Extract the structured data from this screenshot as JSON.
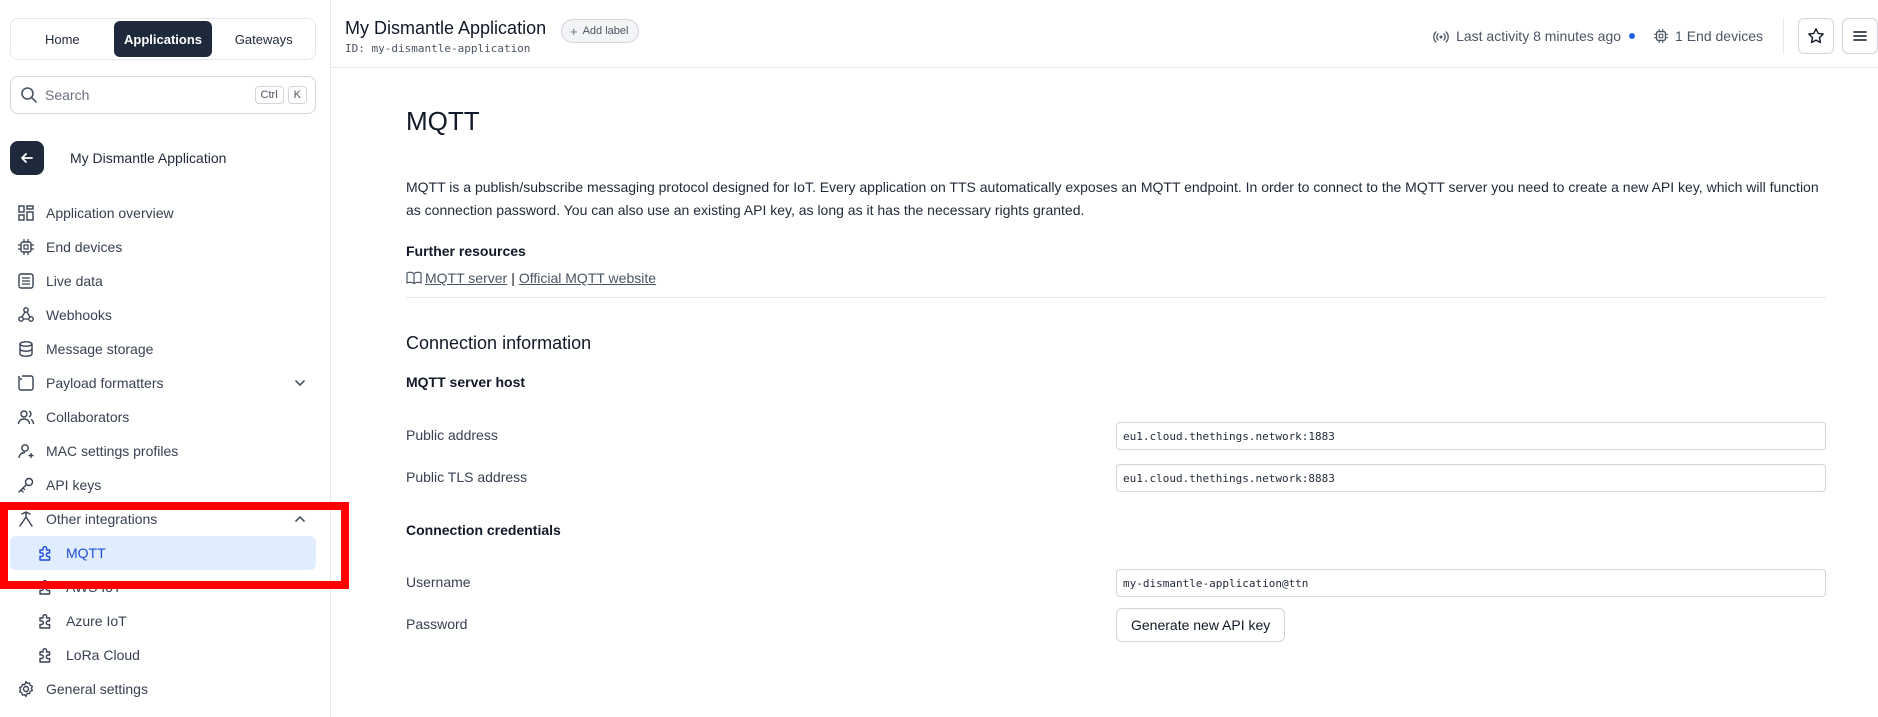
{
  "nav_switch": {
    "home": "Home",
    "applications": "Applications",
    "gateways": "Gateways"
  },
  "search": {
    "placeholder": "Search",
    "kbd_ctrl": "Ctrl",
    "kbd_k": "K"
  },
  "app": {
    "name": "My Dismantle Application"
  },
  "sidebar": {
    "items": [
      {
        "label": "Application overview",
        "icon": "grid-icon"
      },
      {
        "label": "End devices",
        "icon": "chip-icon"
      },
      {
        "label": "Live data",
        "icon": "list-icon"
      },
      {
        "label": "Webhooks",
        "icon": "webhook-icon"
      },
      {
        "label": "Message storage",
        "icon": "database-icon"
      },
      {
        "label": "Payload formatters",
        "icon": "code-icon"
      },
      {
        "label": "Collaborators",
        "icon": "users-icon"
      },
      {
        "label": "MAC settings profiles",
        "icon": "user-settings-icon"
      },
      {
        "label": "API keys",
        "icon": "key-icon"
      },
      {
        "label": "Other integrations",
        "icon": "integrations-icon"
      }
    ],
    "sub_items": [
      {
        "label": "MQTT",
        "icon": "puzzle-icon"
      },
      {
        "label": "AWS IoT",
        "icon": "puzzle-icon"
      },
      {
        "label": "Azure IoT",
        "icon": "puzzle-icon"
      },
      {
        "label": "LoRa Cloud",
        "icon": "puzzle-icon"
      }
    ],
    "general_settings": "General settings"
  },
  "header": {
    "title": "My Dismantle Application",
    "add_label": "Add label",
    "id_text": "ID: my-dismantle-application",
    "last_activity": "Last activity 8 minutes ago",
    "end_devices": "1 End devices"
  },
  "main": {
    "title": "MQTT",
    "intro": "MQTT is a publish/subscribe messaging protocol designed for IoT. Every application on TTS automatically exposes an MQTT endpoint. In order to connect to the MQTT server you need to create a new API key, which will function as connection password. You can also use an existing API key, as long as it has the necessary rights granted.",
    "further_resources": "Further resources",
    "link_mqtt_server": "MQTT server",
    "link_separator": "|",
    "link_official": "Official MQTT website",
    "connection_information": "Connection information",
    "server_host": "MQTT server host",
    "public_address_label": "Public address",
    "public_address_value": "eu1.cloud.thethings.network:1883",
    "public_tls_label": "Public TLS address",
    "public_tls_value": "eu1.cloud.thethings.network:8883",
    "connection_credentials": "Connection credentials",
    "username_label": "Username",
    "username_value": "my-dismantle-application@ttn",
    "password_label": "Password",
    "generate_button": "Generate new API key"
  },
  "colors": {
    "accent": "#1e293b",
    "active_bg": "#e0ecff",
    "highlight": "#ff0000",
    "activity_dot": "#2563eb"
  }
}
